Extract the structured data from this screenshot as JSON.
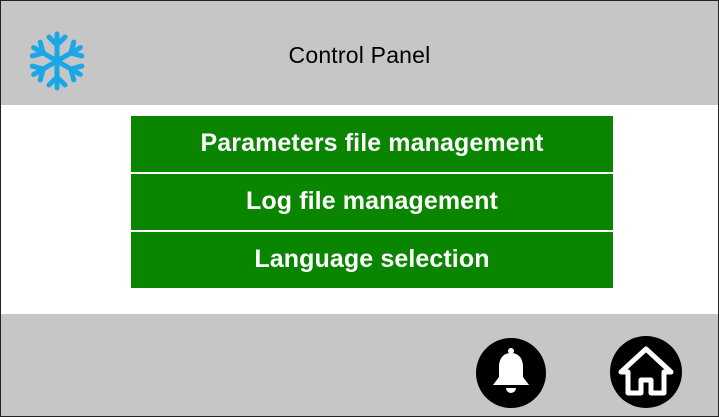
{
  "header": {
    "title": "Control Panel",
    "logo_icon": "snowflake-icon",
    "logo_color": "#1aa7e8"
  },
  "menu": {
    "items": [
      {
        "label": "Parameters file management"
      },
      {
        "label": "Log file management"
      },
      {
        "label": "Language selection"
      }
    ],
    "button_color": "#0a8500",
    "text_color": "#ffffff"
  },
  "footer": {
    "buttons": [
      {
        "icon": "bell-icon"
      },
      {
        "icon": "home-icon"
      }
    ],
    "background": "#c6c6c6"
  }
}
